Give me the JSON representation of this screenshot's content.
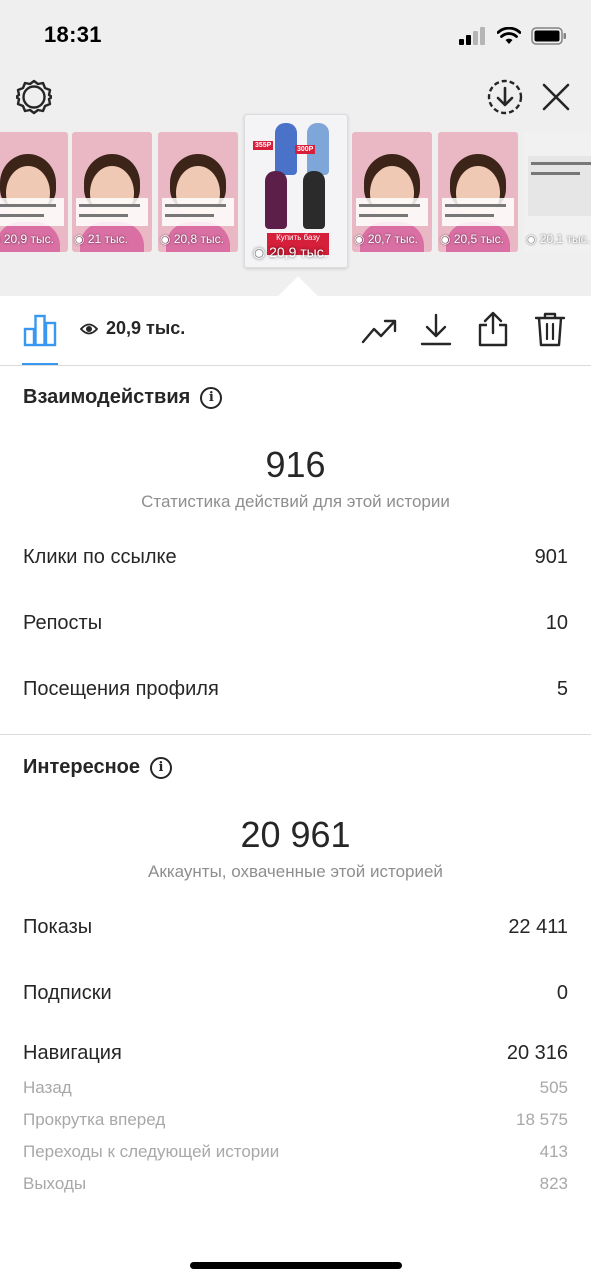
{
  "status_bar": {
    "time": "18:31"
  },
  "header": {
    "left_icon": "settings-gear-icon",
    "right_icons": [
      "save-download-icon",
      "close-icon"
    ]
  },
  "stories": [
    {
      "views": "20,9 тыс."
    },
    {
      "views": "21 тыс."
    },
    {
      "views": "20,8 тыс."
    },
    {
      "views": "20,9 тыс.",
      "selected": true,
      "promo": {
        "price1": "355Р",
        "price2": "300Р",
        "cta": "Купить базу"
      }
    },
    {
      "views": "20,7 тыс."
    },
    {
      "views": "20,5 тыс."
    },
    {
      "views": "20,1 тыс."
    }
  ],
  "toolbar": {
    "views": "20,9 тыс.",
    "icons": [
      "insights-bar-chart-icon",
      "eye-icon",
      "trend-arrow-icon",
      "download-icon",
      "share-icon",
      "trash-icon"
    ]
  },
  "interactions": {
    "title": "Взаимодействия",
    "total": "916",
    "caption": "Статистика действий для этой истории",
    "rows": [
      {
        "label": "Клики по ссылке",
        "value": "901"
      },
      {
        "label": "Репосты",
        "value": "10"
      },
      {
        "label": "Посещения профиля",
        "value": "5"
      }
    ]
  },
  "discovery": {
    "title": "Интересное",
    "total": "20 961",
    "caption": "Аккаунты, охваченные этой историей",
    "rows": [
      {
        "label": "Показы",
        "value": "22 411"
      },
      {
        "label": "Подписки",
        "value": "0"
      },
      {
        "label": "Навигация",
        "value": "20 316"
      }
    ],
    "navigation_breakdown": [
      {
        "label": "Назад",
        "value": "505"
      },
      {
        "label": "Прокрутка вперед",
        "value": "18 575"
      },
      {
        "label": "Переходы к следующей истории",
        "value": "413"
      },
      {
        "label": "Выходы",
        "value": "823"
      }
    ]
  },
  "colors": {
    "accent": "#3897f0",
    "text": "#262626",
    "secondary": "#8e8e8e",
    "promo_red": "#d61f3a"
  }
}
